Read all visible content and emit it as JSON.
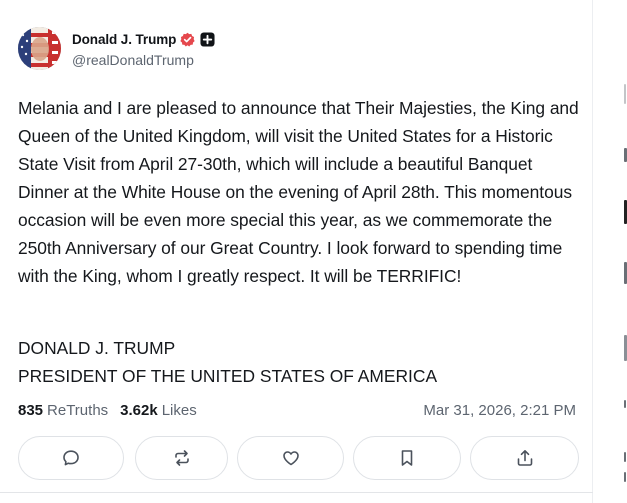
{
  "post": {
    "display_name": "Donald J. Trump",
    "handle": "@realDonaldTrump",
    "body": "Melania and I are pleased to announce that Their Majesties, the King and Queen of the United Kingdom, will visit the United States for a Historic State Visit from April 27-30th, which will include a beautiful Banquet Dinner at the White House on the evening of April 28th. This momentous occasion will be even more special this year, as we commemorate the 250th Anniversary of our Great Country. I look forward to spending time with the King, whom I greatly respect. It will be TERRIFIC!",
    "signature_line1": "DONALD J. TRUMP",
    "signature_line2": "PRESIDENT OF THE UNITED STATES OF AMERICA",
    "retruths_count": "835",
    "retruths_label": "ReTruths",
    "likes_count": "3.62k",
    "likes_label": "Likes",
    "timestamp": "Mar 31, 2026, 2:21 PM"
  },
  "colors": {
    "verified_badge": "#e5484d",
    "text_primary": "#15181c",
    "text_secondary": "#5d6570",
    "button_border": "#dfe2e6"
  },
  "actions": [
    {
      "icon": "reply-icon"
    },
    {
      "icon": "retruth-icon"
    },
    {
      "icon": "like-icon"
    },
    {
      "icon": "bookmark-icon"
    },
    {
      "icon": "share-icon"
    }
  ]
}
